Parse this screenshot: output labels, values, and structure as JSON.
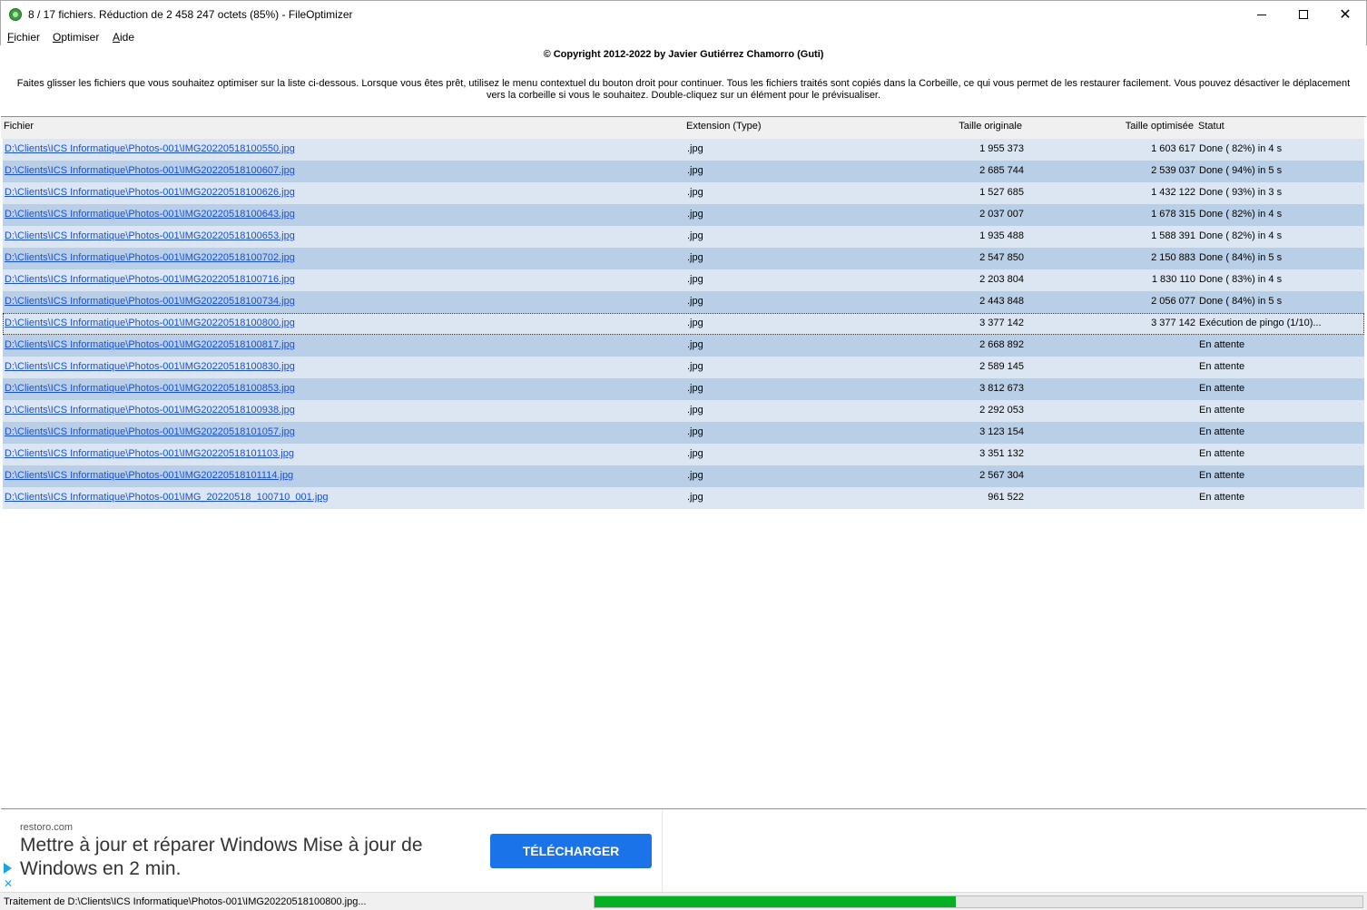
{
  "window": {
    "title": "8 / 17 fichiers. Réduction de 2 458 247 octets (85%) - FileOptimizer"
  },
  "menu": {
    "items": [
      {
        "label": "Fichier",
        "underline": "F"
      },
      {
        "label": "Optimiser",
        "underline": "O"
      },
      {
        "label": "Aide",
        "underline": "A"
      }
    ]
  },
  "header": {
    "copyright": "© Copyright 2012-2022 by Javier Gutiérrez Chamorro (Guti)",
    "instructions": "Faites glisser les fichiers que vous souhaitez optimiser sur la liste ci-dessous. Lorsque vous êtes prêt, utilisez le menu contextuel du bouton droit pour continuer. Tous les fichiers traités sont copiés dans la Corbeille, ce qui vous permet de les restaurer facilement. Vous pouvez désactiver le déplacement vers la corbeille si vous le souhaitez. Double-cliquez sur un élément pour le prévisualiser."
  },
  "list": {
    "columns": {
      "file": "Fichier",
      "ext": "Extension (Type)",
      "orig": "Taille originale",
      "opt": "Taille optimisée",
      "status": "Statut"
    },
    "rows": [
      {
        "file": "D:\\Clients\\ICS Informatique\\Photos-001\\IMG20220518100550.jpg",
        "ext": ".jpg",
        "orig": "1 955 373",
        "opt": "1 603 617",
        "status": "Done ( 82%) in  4 s"
      },
      {
        "file": "D:\\Clients\\ICS Informatique\\Photos-001\\IMG20220518100607.jpg",
        "ext": ".jpg",
        "orig": "2 685 744",
        "opt": "2 539 037",
        "status": "Done ( 94%) in  5 s"
      },
      {
        "file": "D:\\Clients\\ICS Informatique\\Photos-001\\IMG20220518100626.jpg",
        "ext": ".jpg",
        "orig": "1 527 685",
        "opt": "1 432 122",
        "status": "Done ( 93%) in  3 s"
      },
      {
        "file": "D:\\Clients\\ICS Informatique\\Photos-001\\IMG20220518100643.jpg",
        "ext": ".jpg",
        "orig": "2 037 007",
        "opt": "1 678 315",
        "status": "Done ( 82%) in  4 s"
      },
      {
        "file": "D:\\Clients\\ICS Informatique\\Photos-001\\IMG20220518100653.jpg",
        "ext": ".jpg",
        "orig": "1 935 488",
        "opt": "1 588 391",
        "status": "Done ( 82%) in  4 s"
      },
      {
        "file": "D:\\Clients\\ICS Informatique\\Photos-001\\IMG20220518100702.jpg",
        "ext": ".jpg",
        "orig": "2 547 850",
        "opt": "2 150 883",
        "status": "Done ( 84%) in  5 s"
      },
      {
        "file": "D:\\Clients\\ICS Informatique\\Photos-001\\IMG20220518100716.jpg",
        "ext": ".jpg",
        "orig": "2 203 804",
        "opt": "1 830 110",
        "status": "Done ( 83%) in  4 s"
      },
      {
        "file": "D:\\Clients\\ICS Informatique\\Photos-001\\IMG20220518100734.jpg",
        "ext": ".jpg",
        "orig": "2 443 848",
        "opt": "2 056 077",
        "status": "Done ( 84%) in  5 s"
      },
      {
        "file": "D:\\Clients\\ICS Informatique\\Photos-001\\IMG20220518100800.jpg",
        "ext": ".jpg",
        "orig": "3 377 142",
        "opt": "3 377 142",
        "status": "Exécution de pingo (1/10)...",
        "current": true
      },
      {
        "file": "D:\\Clients\\ICS Informatique\\Photos-001\\IMG20220518100817.jpg",
        "ext": ".jpg",
        "orig": "2 668 892",
        "opt": "",
        "status": "En attente"
      },
      {
        "file": "D:\\Clients\\ICS Informatique\\Photos-001\\IMG20220518100830.jpg",
        "ext": ".jpg",
        "orig": "2 589 145",
        "opt": "",
        "status": "En attente"
      },
      {
        "file": "D:\\Clients\\ICS Informatique\\Photos-001\\IMG20220518100853.jpg",
        "ext": ".jpg",
        "orig": "3 812 673",
        "opt": "",
        "status": "En attente"
      },
      {
        "file": "D:\\Clients\\ICS Informatique\\Photos-001\\IMG20220518100938.jpg",
        "ext": ".jpg",
        "orig": "2 292 053",
        "opt": "",
        "status": "En attente"
      },
      {
        "file": "D:\\Clients\\ICS Informatique\\Photos-001\\IMG20220518101057.jpg",
        "ext": ".jpg",
        "orig": "3 123 154",
        "opt": "",
        "status": "En attente"
      },
      {
        "file": "D:\\Clients\\ICS Informatique\\Photos-001\\IMG20220518101103.jpg",
        "ext": ".jpg",
        "orig": "3 351 132",
        "opt": "",
        "status": "En attente"
      },
      {
        "file": "D:\\Clients\\ICS Informatique\\Photos-001\\IMG20220518101114.jpg",
        "ext": ".jpg",
        "orig": "2 567 304",
        "opt": "",
        "status": "En attente"
      },
      {
        "file": "D:\\Clients\\ICS Informatique\\Photos-001\\IMG_20220518_100710_001.jpg",
        "ext": ".jpg",
        "orig": "961 522",
        "opt": "",
        "status": "En attente"
      }
    ]
  },
  "ad": {
    "domain": "restoro.com",
    "headline": "Mettre à jour et réparer Windows Mise à jour de Windows en 2 min.",
    "button": "TÉLÉCHARGER",
    "accent_color": "#1a73e8"
  },
  "statusbar": {
    "text": "Traitement de D:\\Clients\\ICS Informatique\\Photos-001\\IMG20220518100800.jpg...",
    "progress": 0.47,
    "progress_color": "#06b025"
  },
  "icons": {
    "app": "fileoptimizer-app-icon",
    "minimize": "minimize-icon",
    "maximize": "maximize-icon",
    "close": "close-icon",
    "ad_play": "ad-choices-play-icon",
    "ad_close": "ad-close-icon"
  }
}
